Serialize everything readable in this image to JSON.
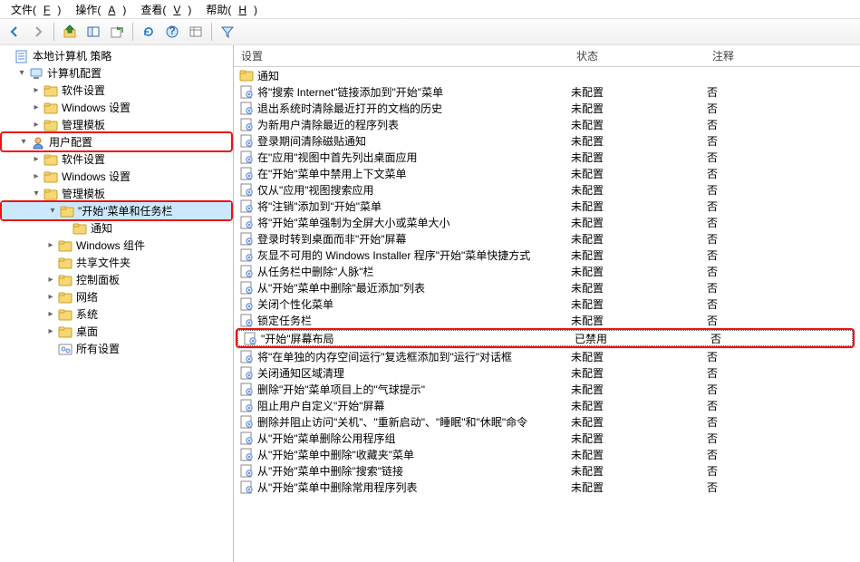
{
  "menubar": [
    {
      "label": "文件",
      "accel": "F"
    },
    {
      "label": "操作",
      "accel": "A"
    },
    {
      "label": "查看",
      "accel": "V"
    },
    {
      "label": "帮助",
      "accel": "H"
    }
  ],
  "toolbar_icons": [
    "back",
    "forward",
    "up",
    "show-hide",
    "export",
    "refresh",
    "help",
    "prop",
    "filter"
  ],
  "tree": [
    {
      "indent": 0,
      "expander": "none",
      "icon": "policy",
      "label": "本地计算机 策略",
      "name": "tree-root",
      "hl": false
    },
    {
      "indent": 1,
      "expander": "open",
      "icon": "computer",
      "label": "计算机配置",
      "name": "tree-computer-config",
      "hl": false
    },
    {
      "indent": 2,
      "expander": "closed",
      "icon": "folder",
      "label": "软件设置",
      "name": "tree-cc-software",
      "hl": false
    },
    {
      "indent": 2,
      "expander": "closed",
      "icon": "folder",
      "label": "Windows 设置",
      "name": "tree-cc-windows",
      "hl": false
    },
    {
      "indent": 2,
      "expander": "closed",
      "icon": "folder",
      "label": "管理模板",
      "name": "tree-cc-templates",
      "hl": false
    },
    {
      "indent": 1,
      "expander": "open",
      "icon": "user",
      "label": "用户配置",
      "name": "tree-user-config",
      "hl": true
    },
    {
      "indent": 2,
      "expander": "closed",
      "icon": "folder",
      "label": "软件设置",
      "name": "tree-uc-software",
      "hl": false
    },
    {
      "indent": 2,
      "expander": "closed",
      "icon": "folder",
      "label": "Windows 设置",
      "name": "tree-uc-windows",
      "hl": false
    },
    {
      "indent": 2,
      "expander": "open",
      "icon": "folder",
      "label": "管理模板",
      "name": "tree-uc-templates",
      "hl": false
    },
    {
      "indent": 3,
      "expander": "open",
      "icon": "folder",
      "label": "\"开始\"菜单和任务栏",
      "name": "tree-start-taskbar",
      "hl": true,
      "selected": true
    },
    {
      "indent": 4,
      "expander": "none",
      "icon": "folder",
      "label": "通知",
      "name": "tree-notify",
      "hl": false
    },
    {
      "indent": 3,
      "expander": "closed",
      "icon": "folder",
      "label": "Windows 组件",
      "name": "tree-win-components",
      "hl": false
    },
    {
      "indent": 3,
      "expander": "none",
      "icon": "folder",
      "label": "共享文件夹",
      "name": "tree-shared",
      "hl": false
    },
    {
      "indent": 3,
      "expander": "closed",
      "icon": "folder",
      "label": "控制面板",
      "name": "tree-control-panel",
      "hl": false
    },
    {
      "indent": 3,
      "expander": "closed",
      "icon": "folder",
      "label": "网络",
      "name": "tree-network",
      "hl": false
    },
    {
      "indent": 3,
      "expander": "closed",
      "icon": "folder",
      "label": "系统",
      "name": "tree-system",
      "hl": false
    },
    {
      "indent": 3,
      "expander": "closed",
      "icon": "folder",
      "label": "桌面",
      "name": "tree-desktop",
      "hl": false
    },
    {
      "indent": 3,
      "expander": "none",
      "icon": "allsettings",
      "label": "所有设置",
      "name": "tree-all-settings",
      "hl": false
    }
  ],
  "columns": {
    "setting": "设置",
    "status": "状态",
    "comment": "注释"
  },
  "rows": [
    {
      "icon": "folder",
      "setting": "通知",
      "status": "",
      "comment": ""
    },
    {
      "icon": "setting",
      "setting": "将\"搜索 Internet\"链接添加到\"开始\"菜单",
      "status": "未配置",
      "comment": "否"
    },
    {
      "icon": "setting",
      "setting": "退出系统时清除最近打开的文档的历史",
      "status": "未配置",
      "comment": "否"
    },
    {
      "icon": "setting",
      "setting": "为新用户清除最近的程序列表",
      "status": "未配置",
      "comment": "否"
    },
    {
      "icon": "setting",
      "setting": "登录期间清除磁贴通知",
      "status": "未配置",
      "comment": "否"
    },
    {
      "icon": "setting",
      "setting": "在\"应用\"视图中首先列出桌面应用",
      "status": "未配置",
      "comment": "否"
    },
    {
      "icon": "setting",
      "setting": "在\"开始\"菜单中禁用上下文菜单",
      "status": "未配置",
      "comment": "否"
    },
    {
      "icon": "setting",
      "setting": "仅从\"应用\"视图搜索应用",
      "status": "未配置",
      "comment": "否"
    },
    {
      "icon": "setting",
      "setting": "将\"注销\"添加到\"开始\"菜单",
      "status": "未配置",
      "comment": "否"
    },
    {
      "icon": "setting",
      "setting": "将\"开始\"菜单强制为全屏大小或菜单大小",
      "status": "未配置",
      "comment": "否"
    },
    {
      "icon": "setting",
      "setting": "登录时转到桌面而非\"开始\"屏幕",
      "status": "未配置",
      "comment": "否"
    },
    {
      "icon": "setting",
      "setting": "灰显不可用的 Windows Installer 程序\"开始\"菜单快捷方式",
      "status": "未配置",
      "comment": "否"
    },
    {
      "icon": "setting",
      "setting": "从任务栏中删除\"人脉\"栏",
      "status": "未配置",
      "comment": "否"
    },
    {
      "icon": "setting",
      "setting": "从\"开始\"菜单中删除\"最近添加\"列表",
      "status": "未配置",
      "comment": "否"
    },
    {
      "icon": "setting",
      "setting": "关闭个性化菜单",
      "status": "未配置",
      "comment": "否"
    },
    {
      "icon": "setting",
      "setting": "锁定任务栏",
      "status": "未配置",
      "comment": "否"
    },
    {
      "icon": "setting",
      "setting": "\"开始\"屏幕布局",
      "status": "已禁用",
      "comment": "否",
      "hl": true,
      "focused": true
    },
    {
      "icon": "setting",
      "setting": "将\"在单独的内存空间运行\"复选框添加到\"运行\"对话框",
      "status": "未配置",
      "comment": "否"
    },
    {
      "icon": "setting",
      "setting": "关闭通知区域清理",
      "status": "未配置",
      "comment": "否"
    },
    {
      "icon": "setting",
      "setting": "删除\"开始\"菜单项目上的\"气球提示\"",
      "status": "未配置",
      "comment": "否"
    },
    {
      "icon": "setting",
      "setting": "阻止用户自定义\"开始\"屏幕",
      "status": "未配置",
      "comment": "否"
    },
    {
      "icon": "setting",
      "setting": "删除并阻止访问\"关机\"、\"重新启动\"、\"睡眠\"和\"休眠\"命令",
      "status": "未配置",
      "comment": "否"
    },
    {
      "icon": "setting",
      "setting": "从\"开始\"菜单删除公用程序组",
      "status": "未配置",
      "comment": "否"
    },
    {
      "icon": "setting",
      "setting": "从\"开始\"菜单中删除\"收藏夹\"菜单",
      "status": "未配置",
      "comment": "否"
    },
    {
      "icon": "setting",
      "setting": "从\"开始\"菜单中删除\"搜索\"链接",
      "status": "未配置",
      "comment": "否"
    },
    {
      "icon": "setting",
      "setting": "从\"开始\"菜单中删除常用程序列表",
      "status": "未配置",
      "comment": "否"
    }
  ]
}
